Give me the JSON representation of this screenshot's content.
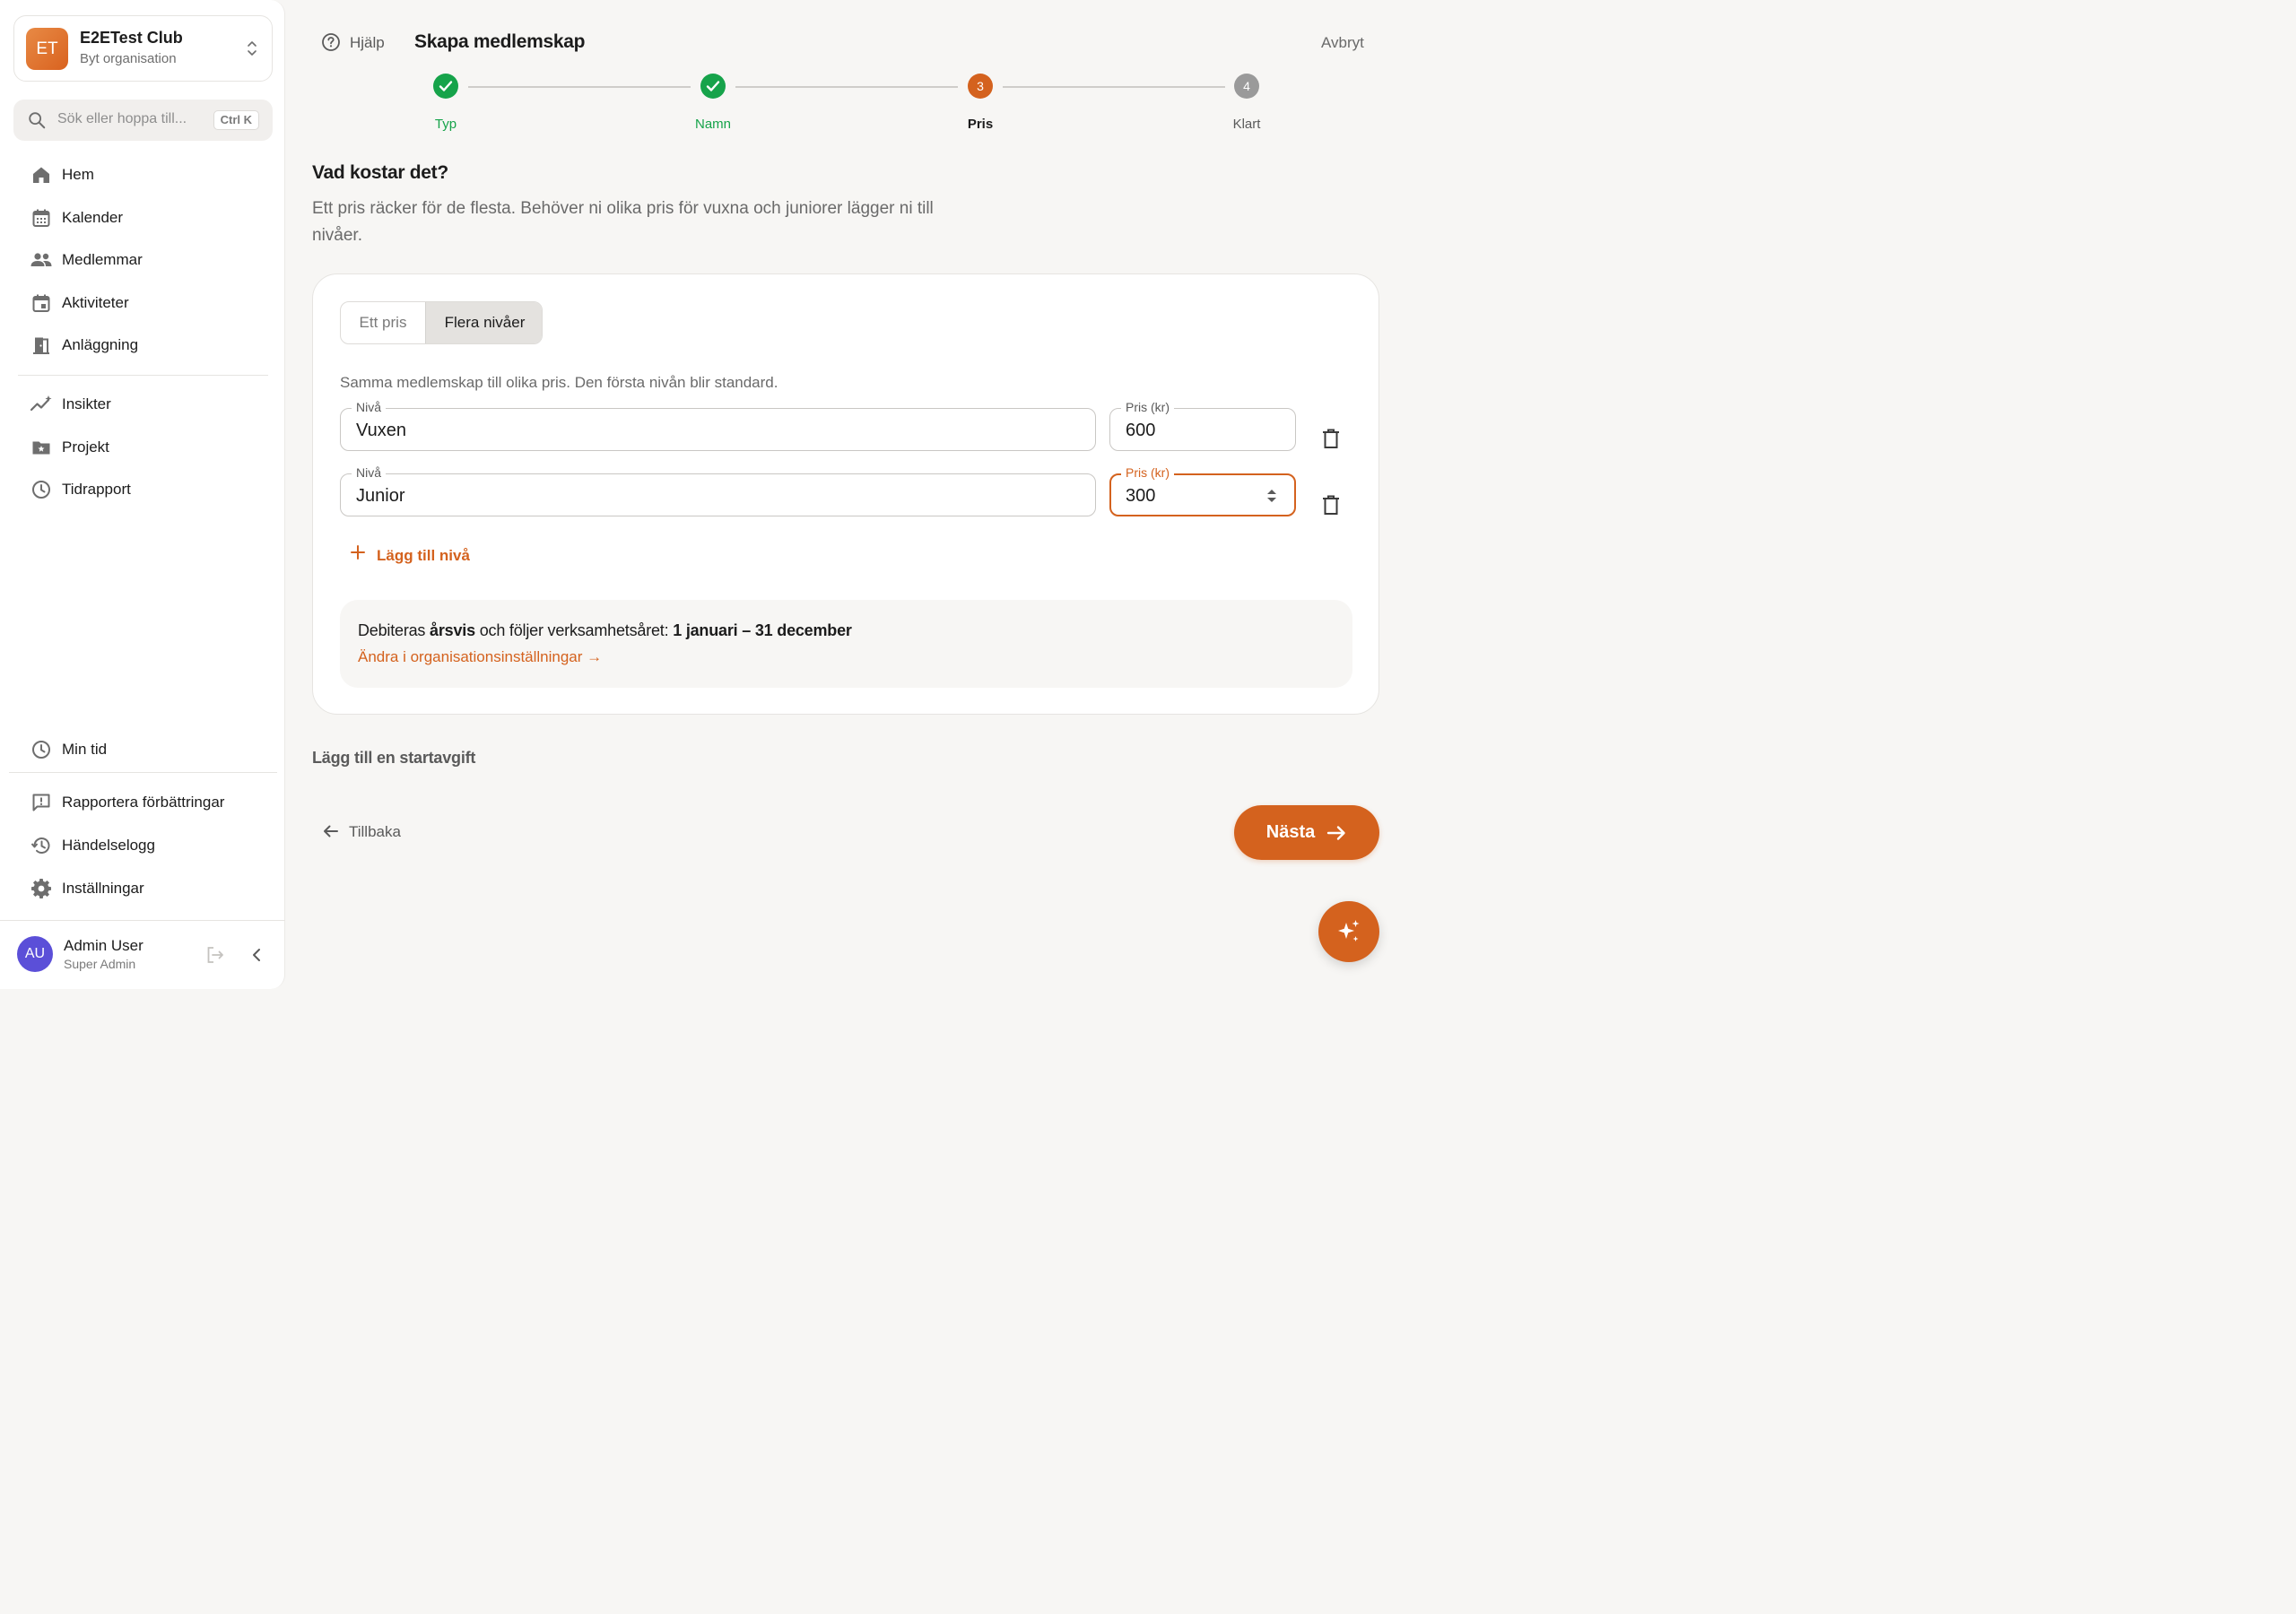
{
  "org": {
    "initials": "ET",
    "name": "E2ETest Club",
    "switch_label": "Byt organisation",
    "switch_icon": "chevron-up-down-icon",
    "brand_color": "#d9621f"
  },
  "search": {
    "placeholder": "Sök eller hoppa till...",
    "shortcut": "Ctrl K"
  },
  "nav": {
    "main": [
      {
        "label": "Hem",
        "icon": "home-icon"
      },
      {
        "label": "Kalender",
        "icon": "calendar-icon"
      },
      {
        "label": "Medlemmar",
        "icon": "people-icon"
      },
      {
        "label": "Aktiviteter",
        "icon": "event-icon"
      },
      {
        "label": "Anläggning",
        "icon": "door-icon"
      }
    ],
    "secondary": [
      {
        "label": "Insikter",
        "icon": "insights-icon"
      },
      {
        "label": "Projekt",
        "icon": "folder-star-icon"
      },
      {
        "label": "Tidrapport",
        "icon": "clock-icon"
      }
    ],
    "bottom": [
      {
        "label": "Min tid",
        "icon": "clock-icon"
      }
    ],
    "footer": [
      {
        "label": "Rapportera förbättringar",
        "icon": "feedback-icon"
      },
      {
        "label": "Händelselogg",
        "icon": "history-icon"
      },
      {
        "label": "Inställningar",
        "icon": "gear-icon"
      }
    ]
  },
  "user": {
    "initials": "AU",
    "name": "Admin User",
    "role": "Super Admin"
  },
  "header": {
    "help_label": "Hjälp",
    "title": "Skapa medlemskap",
    "cancel_label": "Avbryt"
  },
  "stepper": {
    "steps": [
      {
        "label": "Typ",
        "state": "done"
      },
      {
        "label": "Namn",
        "state": "done"
      },
      {
        "label": "Pris",
        "state": "current",
        "number": "3"
      },
      {
        "label": "Klart",
        "state": "upcoming",
        "number": "4"
      }
    ],
    "done_color": "#16a34a",
    "current_color": "#d4621e",
    "upcoming_color": "#9a9a9a"
  },
  "section": {
    "title": "Vad kostar det?",
    "description": "Ett pris räcker för de flesta. Behöver ni olika pris för vuxna och juniorer lägger ni till nivåer."
  },
  "pricing": {
    "mode_options": [
      "Ett pris",
      "Flera nivåer"
    ],
    "selected_mode": "Flera nivåer",
    "description": "Samma medlemskap till olika pris. Den första nivån blir standard.",
    "level_label": "Nivå",
    "price_label": "Pris (kr)",
    "levels": [
      {
        "name": "Vuxen",
        "price": "600"
      },
      {
        "name": "Junior",
        "price": "300"
      }
    ],
    "add_level_label": "Lägg till nivå",
    "billing": {
      "prefix": "Debiteras ",
      "frequency": "årsvis",
      "middle": " och följer verksamhetsåret: ",
      "period": "1 januari – 31 december",
      "link": "Ändra i organisationsinställningar →"
    }
  },
  "start_fee_label": "Lägg till en startavgift",
  "footer_actions": {
    "back_label": "Tillbaka",
    "next_label": "Nästa"
  },
  "accent_color": "#d4621e"
}
